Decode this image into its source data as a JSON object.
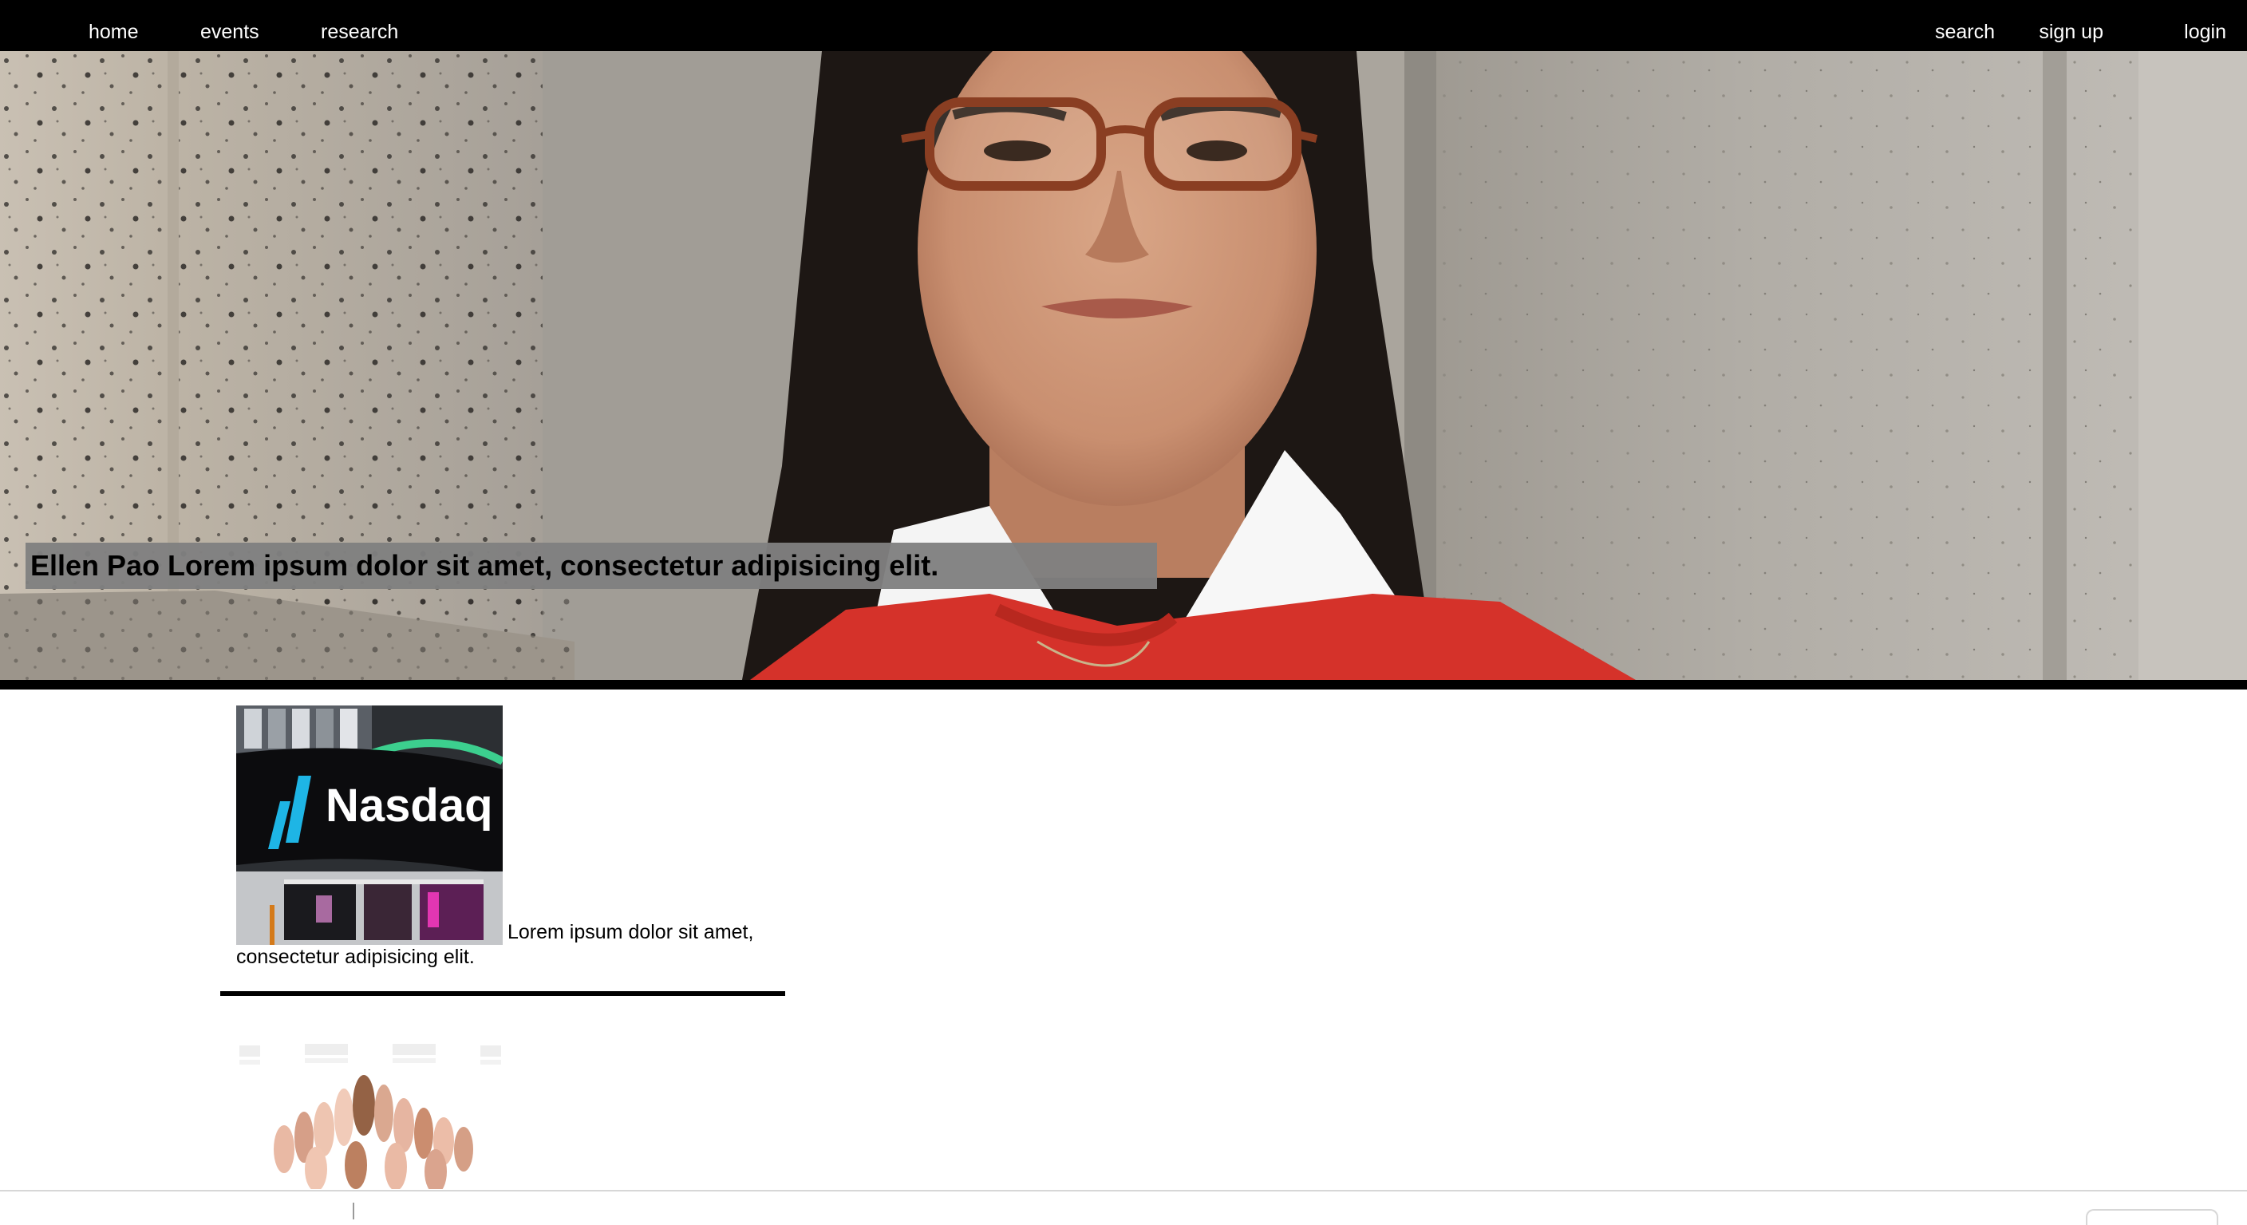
{
  "nav": {
    "left": [
      "home",
      "events",
      "research"
    ],
    "right": [
      "search",
      "sign up",
      "login"
    ]
  },
  "hero": {
    "caption": "Ellen Pao Lorem ipsum dolor sit amet, consectetur adipisicing elit."
  },
  "articles": [
    {
      "image_text": "Nasdaq",
      "text": "Lorem ipsum dolor sit amet, consectetur adipisicing elit."
    }
  ],
  "colors": {
    "nav_bg": "#000000",
    "nav_text": "#ffffff",
    "caption_bg": "#808080",
    "divider": "#000000"
  }
}
